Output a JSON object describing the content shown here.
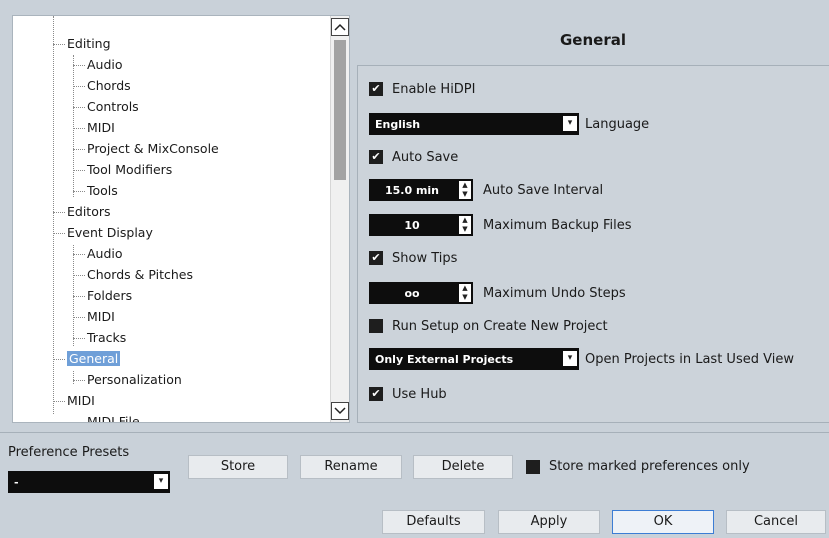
{
  "tree": {
    "items": [
      {
        "label": "Editing"
      },
      {
        "label": "Audio"
      },
      {
        "label": "Chords"
      },
      {
        "label": "Controls"
      },
      {
        "label": "MIDI"
      },
      {
        "label": "Project & MixConsole"
      },
      {
        "label": "Tool Modifiers"
      },
      {
        "label": "Tools"
      },
      {
        "label": "Editors"
      },
      {
        "label": "Event Display"
      },
      {
        "label": "Audio"
      },
      {
        "label": "Chords & Pitches"
      },
      {
        "label": "Folders"
      },
      {
        "label": "MIDI"
      },
      {
        "label": "Tracks"
      },
      {
        "label": "General"
      },
      {
        "label": "Personalization"
      },
      {
        "label": "MIDI"
      },
      {
        "label": "MIDI File"
      }
    ],
    "selected": "General"
  },
  "section": {
    "title": "General",
    "enable_hidpi": {
      "label": "Enable HiDPI",
      "checked": true
    },
    "language": {
      "value": "English",
      "label": "Language"
    },
    "auto_save": {
      "label": "Auto Save",
      "checked": true
    },
    "auto_save_interval": {
      "value": "15.0 min",
      "label": "Auto Save Interval"
    },
    "max_backup": {
      "value": "10",
      "label": "Maximum Backup Files"
    },
    "show_tips": {
      "label": "Show Tips",
      "checked": true
    },
    "max_undo": {
      "value": "oo",
      "label": "Maximum Undo Steps"
    },
    "run_setup": {
      "label": "Run Setup on Create New Project",
      "checked": false
    },
    "open_projects": {
      "value": "Only External Projects",
      "label": "Open Projects in Last Used View"
    },
    "use_hub": {
      "label": "Use Hub",
      "checked": true
    }
  },
  "presets": {
    "label": "Preference Presets",
    "value": "-",
    "store": "Store",
    "rename": "Rename",
    "delete": "Delete",
    "store_marked": {
      "label": "Store marked preferences only",
      "checked": false
    }
  },
  "footer": {
    "defaults": "Defaults",
    "apply": "Apply",
    "ok": "OK",
    "cancel": "Cancel"
  }
}
